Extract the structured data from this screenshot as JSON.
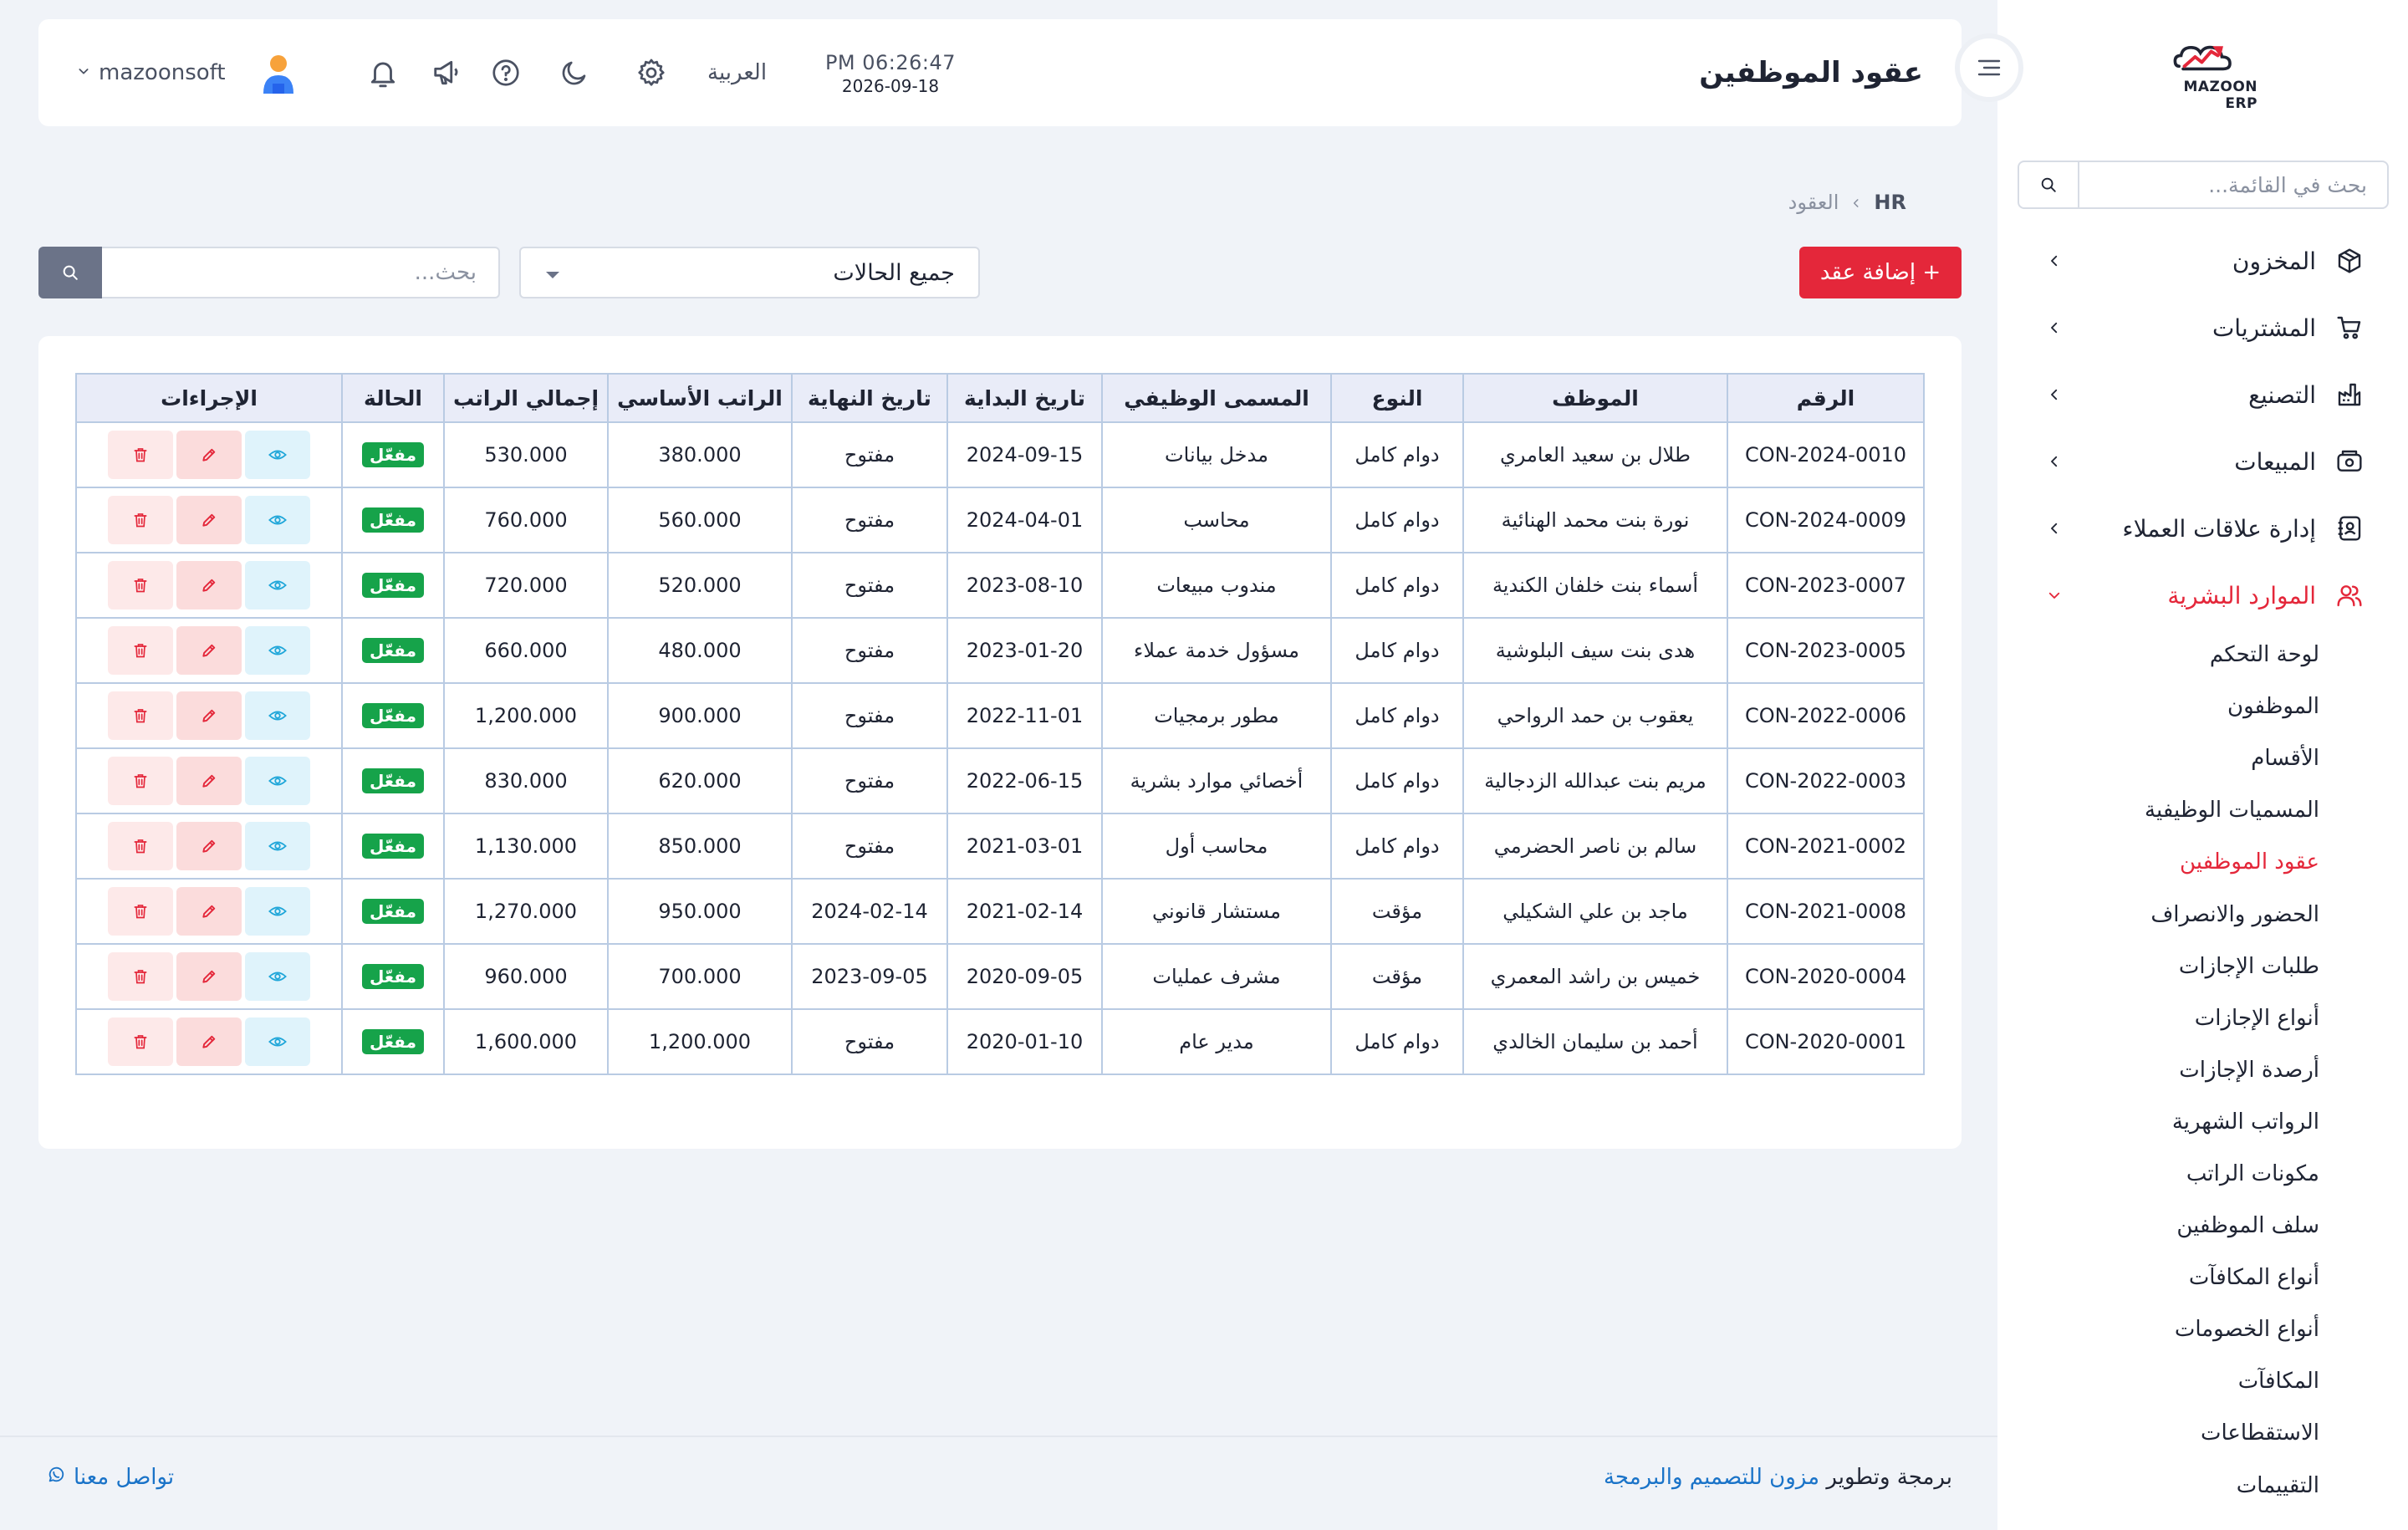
{
  "sidebar": {
    "logo_text": "MAZOON ERP",
    "search_placeholder": "بحث في القائمة...",
    "items": [
      {
        "label": "المخزون",
        "icon": "box-icon"
      },
      {
        "label": "المشتريات",
        "icon": "cart-icon"
      },
      {
        "label": "التصنيع",
        "icon": "factory-icon"
      },
      {
        "label": "المبيعات",
        "icon": "cash-register-icon"
      },
      {
        "label": "إدارة علاقات العملاء",
        "icon": "address-book-icon"
      },
      {
        "label": "الموارد البشرية",
        "icon": "users-icon",
        "active": true
      }
    ],
    "hr_subitems": [
      "لوحة التحكم",
      "الموظفون",
      "الأقسام",
      "المسميات الوظيفية",
      "عقود الموظفين",
      "الحضور والانصراف",
      "طلبات الإجازات",
      "أنواع الإجازات",
      "أرصدة الإجازات",
      "الرواتب الشهرية",
      "مكونات الراتب",
      "سلف الموظفين",
      "أنواع المكافآت",
      "أنواع الخصومات",
      "المكافآت",
      "الاستقطاعات",
      "التقييمات"
    ],
    "active_subitem": "عقود الموظفين"
  },
  "header": {
    "title": "عقود الموظفين",
    "time": "PM 06:26:47",
    "date": "2026-09-18",
    "language": "العربية",
    "username": "mazoonsoft"
  },
  "breadcrumb": {
    "root": "HR",
    "current": "العقود"
  },
  "toolbar": {
    "add_label": "+ إضافة عقد",
    "status_filter": "جميع الحالات",
    "search_placeholder": "بحث..."
  },
  "table": {
    "headers": [
      "الرقم",
      "الموظف",
      "النوع",
      "المسمى الوظيفي",
      "تاريخ البداية",
      "تاريخ النهاية",
      "الراتب الأساسي",
      "إجمالي الراتب",
      "الحالة",
      "الإجراءات"
    ],
    "rows": [
      [
        "CON-2024-0010",
        "طلال بن سعيد العامري",
        "دوام كامل",
        "مدخل بيانات",
        "2024-09-15",
        "مفتوح",
        "380.000",
        "530.000",
        "مفعّل"
      ],
      [
        "CON-2024-0009",
        "نورة بنت محمد الهنائية",
        "دوام كامل",
        "محاسب",
        "2024-04-01",
        "مفتوح",
        "560.000",
        "760.000",
        "مفعّل"
      ],
      [
        "CON-2023-0007",
        "أسماء بنت خلفان الكندية",
        "دوام كامل",
        "مندوب مبيعات",
        "2023-08-10",
        "مفتوح",
        "520.000",
        "720.000",
        "مفعّل"
      ],
      [
        "CON-2023-0005",
        "هدى بنت سيف البلوشية",
        "دوام كامل",
        "مسؤول خدمة عملاء",
        "2023-01-20",
        "مفتوح",
        "480.000",
        "660.000",
        "مفعّل"
      ],
      [
        "CON-2022-0006",
        "يعقوب بن حمد الرواحي",
        "دوام كامل",
        "مطور برمجيات",
        "2022-11-01",
        "مفتوح",
        "900.000",
        "1,200.000",
        "مفعّل"
      ],
      [
        "CON-2022-0003",
        "مريم بنت عبدالله الزدجالية",
        "دوام كامل",
        "أخصائي موارد بشرية",
        "2022-06-15",
        "مفتوح",
        "620.000",
        "830.000",
        "مفعّل"
      ],
      [
        "CON-2021-0002",
        "سالم بن ناصر الحضرمي",
        "دوام كامل",
        "محاسب أول",
        "2021-03-01",
        "مفتوح",
        "850.000",
        "1,130.000",
        "مفعّل"
      ],
      [
        "CON-2021-0008",
        "ماجد بن علي الشكيلي",
        "مؤقت",
        "مستشار قانوني",
        "2021-02-14",
        "2024-02-14",
        "950.000",
        "1,270.000",
        "مفعّل"
      ],
      [
        "CON-2020-0004",
        "خميس بن راشد المعمري",
        "مؤقت",
        "مشرف عمليات",
        "2020-09-05",
        "2023-09-05",
        "700.000",
        "960.000",
        "مفعّل"
      ],
      [
        "CON-2020-0001",
        "أحمد بن سليمان الخالدي",
        "دوام كامل",
        "مدير عام",
        "2020-01-10",
        "مفتوح",
        "1,200.000",
        "1,600.000",
        "مفعّل"
      ]
    ]
  },
  "footer": {
    "contact": "تواصل معنا",
    "credit_prefix": "برمجة وتطوير",
    "credit_link": "مزون للتصميم والبرمجة"
  },
  "colors": {
    "accent": "#e4273a",
    "badge": "#16a34a",
    "link": "#1a73c8",
    "view_icon": "#1fa6d9"
  }
}
